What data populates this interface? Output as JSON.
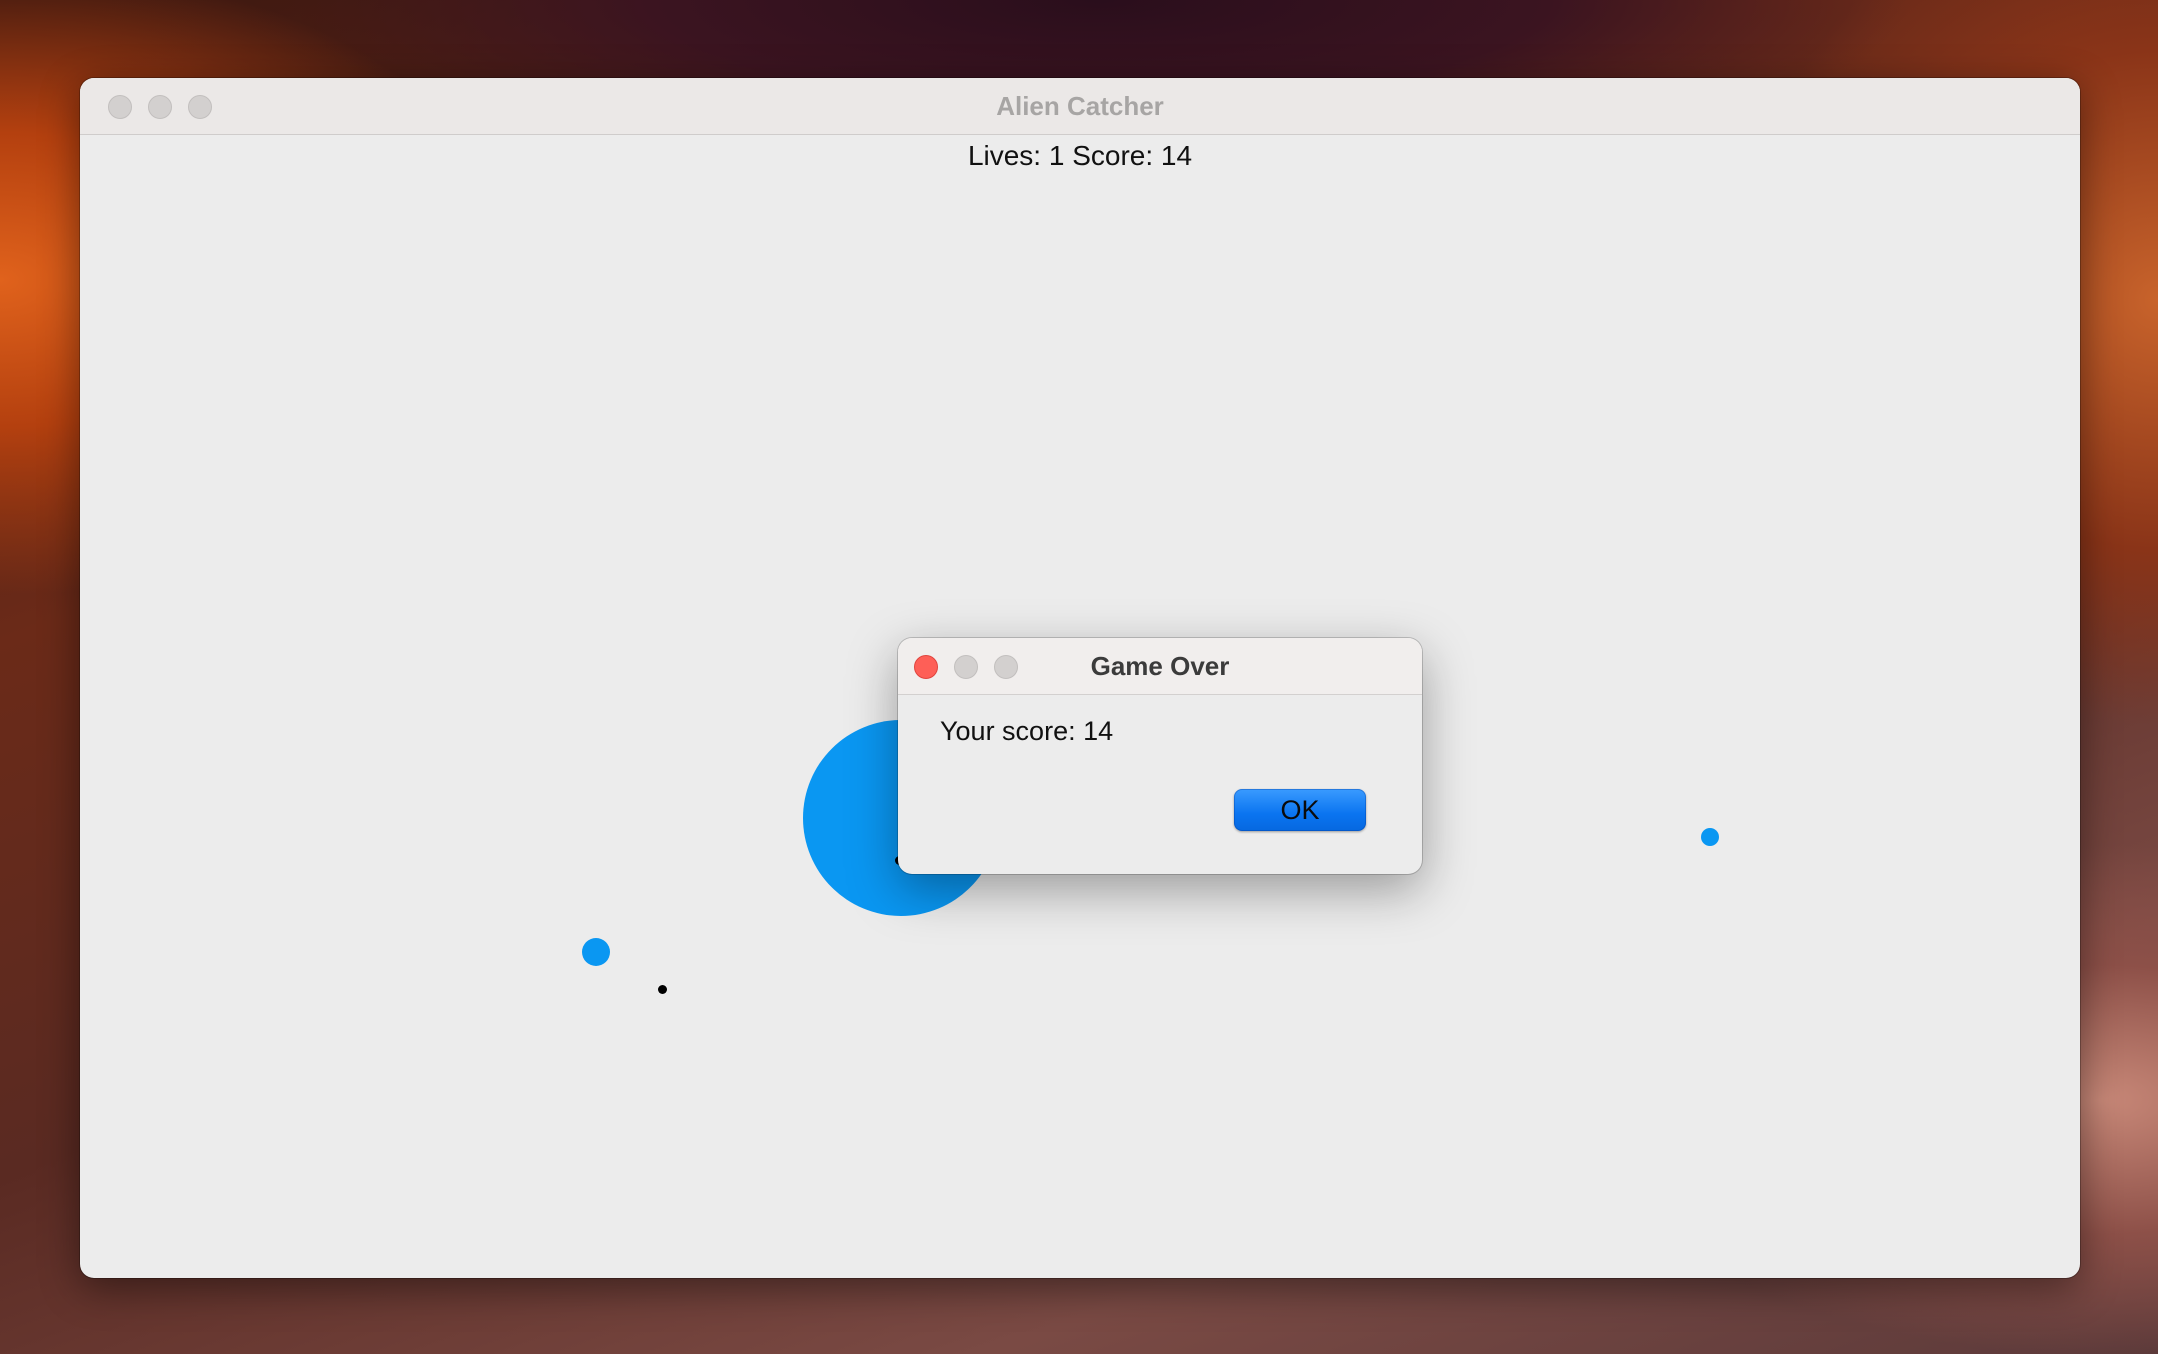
{
  "window": {
    "title": "Alien Catcher"
  },
  "hud": {
    "status_text": "Lives: 1 Score: 14"
  },
  "dialog": {
    "title": "Game Over",
    "message": "Your score: 14",
    "ok_label": "OK"
  },
  "colors": {
    "alien": "#0a97f2",
    "close_button": "#fe5f57",
    "ok_button": "#0a74f0"
  },
  "icons": {
    "close": "close-icon",
    "minimize": "minimize-icon",
    "zoom": "zoom-icon"
  }
}
